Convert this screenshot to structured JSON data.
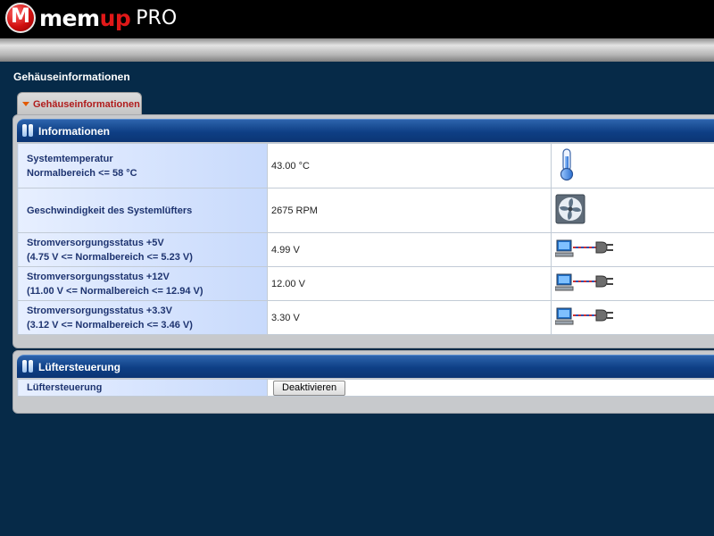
{
  "header": {
    "logo_mark": "M",
    "brand_main": "mem",
    "brand_accent": "up",
    "brand_suffix": "PRO"
  },
  "page": {
    "title": "Gehäuseinformationen"
  },
  "tab": {
    "label": "Gehäuseinformationen"
  },
  "info_panel": {
    "title": "Informationen",
    "rows": [
      {
        "label_line1": "Systemtemperatur",
        "label_line2": "Normalbereich <= 58 °C",
        "value": "43.00 °C",
        "icon": "thermometer-icon"
      },
      {
        "label_line1": "Geschwindigkeit des Systemlüfters",
        "label_line2": "",
        "value": "2675 RPM",
        "icon": "fan-icon"
      },
      {
        "label_line1": "Stromversorgungsstatus +5V",
        "label_line2": "(4.75 V <= Normalbereich <= 5.23 V)",
        "value": "4.99 V",
        "icon": "power-connected-icon"
      },
      {
        "label_line1": "Stromversorgungsstatus +12V",
        "label_line2": "(11.00 V <= Normalbereich <= 12.94 V)",
        "value": "12.00 V",
        "icon": "power-connected-icon"
      },
      {
        "label_line1": "Stromversorgungsstatus +3.3V",
        "label_line2": "(3.12 V <= Normalbereich <= 3.46 V)",
        "value": "3.30 V",
        "icon": "power-connected-icon"
      }
    ]
  },
  "fan_panel": {
    "title": "Lüftersteuerung",
    "row_label": "Lüftersteuerung",
    "button_label": "Deaktivieren"
  },
  "colors": {
    "background": "#062a48",
    "header_bar": "#0e3f85",
    "brand_red": "#e01818",
    "tab_text": "#b01c1c"
  }
}
